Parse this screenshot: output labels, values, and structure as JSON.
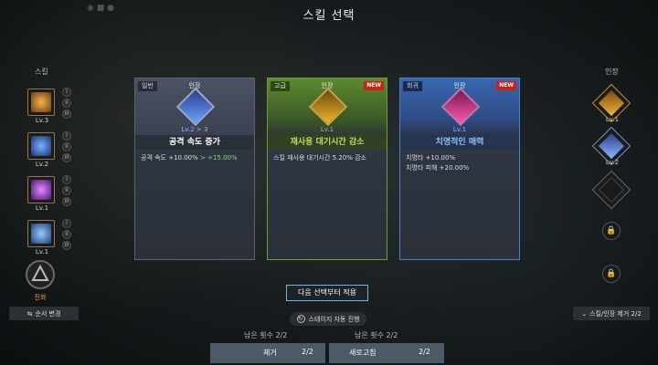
{
  "title": "스킬 선택",
  "left_panel": {
    "label": "스킬",
    "skills": [
      {
        "level": "Lv.3",
        "icon": "bow-skill-icon",
        "color": "#d9902a"
      },
      {
        "level": "Lv.2",
        "icon": "arrow-burst-icon",
        "color": "#3a6fd8"
      },
      {
        "level": "Lv.1",
        "icon": "crossbow-purple-icon",
        "color": "#a93ad8"
      },
      {
        "level": "Lv.1",
        "icon": "arrow-rain-icon",
        "color": "#3a8ad8"
      }
    ],
    "roman": [
      "I",
      "II",
      "III"
    ],
    "evolve_label": "진화",
    "order_button": "순서 변경"
  },
  "cards": [
    {
      "tag": "일반",
      "type": "인장",
      "new": "",
      "level": "Lv.2 > 3",
      "name": "공격 속도 증가",
      "desc": [
        {
          "text": "공격 속도 +10.00%",
          "up": " > +15.00%"
        }
      ]
    },
    {
      "tag": "고급",
      "type": "인장",
      "new": "NEW",
      "level": "Lv.1",
      "name": "재사용 대기시간 감소",
      "desc": [
        {
          "text": "스킬 재사용 대기시간 5.20% 감소",
          "up": ""
        }
      ]
    },
    {
      "tag": "희귀",
      "type": "인장",
      "new": "NEW",
      "level": "Lv.1",
      "name": "치명적인 매력",
      "desc": [
        {
          "text": "치명타 +10.00%",
          "up": ""
        },
        {
          "text": "치명타 피해 +20.00%",
          "up": ""
        }
      ]
    }
  ],
  "apply_button": "다음 선택부터 적용",
  "auto_button": "스테이지 자동 진행",
  "remove": {
    "remaining": "남은 횟수 2/2",
    "label": "제거",
    "count": "2/2"
  },
  "refresh": {
    "remaining": "남은 횟수 2/2",
    "label": "새로고침",
    "count": "2/2"
  },
  "right_panel": {
    "label": "인장",
    "seals": [
      {
        "level": "Lv.1",
        "icon": "speed-seal-icon"
      },
      {
        "level": "Lv.2",
        "icon": "blue-crystal-seal-icon"
      }
    ],
    "reset_button": "스킬/인장 제거 2/2"
  }
}
